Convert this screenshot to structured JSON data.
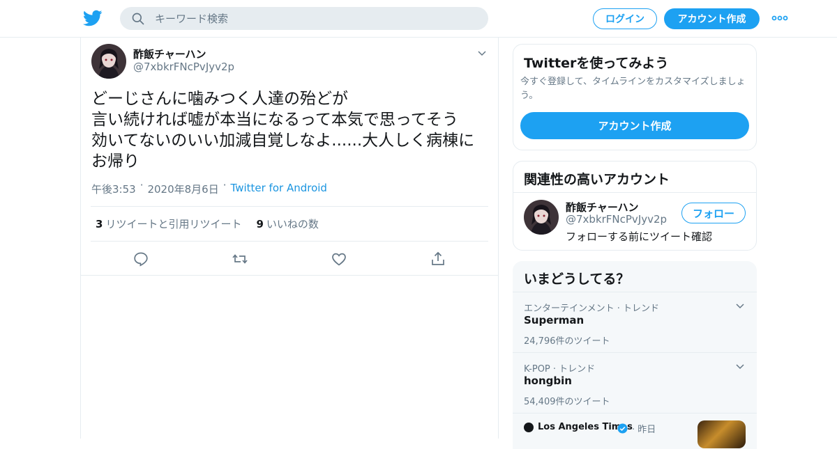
{
  "header": {
    "search_placeholder": "キーワード検索",
    "login_label": "ログイン",
    "signup_label": "アカウント作成",
    "brand_color": "#1da1f2"
  },
  "tweet": {
    "author_name": "酢飯チャーハン",
    "author_handle": "@7xbkrFNcPvJyv2p",
    "text": "どーじさんに噛みつく人達の殆どが\n言い続ければ嘘が本当になるって本気で思ってそう\n効いてないのいい加減自覚しなよ......大人しく病棟に\nお帰り",
    "time": "午後3:53",
    "date": "2020年8月6日",
    "source": "Twitter for Android",
    "retweet_count": "3",
    "retweet_label": "リツイートと引用リツイート",
    "like_count": "9",
    "like_label": "いいねの数"
  },
  "sidebar": {
    "join_card": {
      "title": "Twitterを使ってみよう",
      "description": "今すぐ登録して、タイムラインをカスタマイズしましょう。",
      "button": "アカウント作成"
    },
    "related_card": {
      "title": "関連性の高いアカウント",
      "name": "酢飯チャーハン",
      "handle": "@7xbkrFNcPvJyv2p",
      "follow_label": "フォロー",
      "note": "フォローする前にツイート確認"
    },
    "trends": {
      "title": "いまどうしてる？",
      "items": [
        {
          "category": "エンターテインメント · トレンド",
          "name": "Superman",
          "count": "24,796件のツイート"
        },
        {
          "category": "K-POP · トレンド",
          "name": "hongbin",
          "count": "54,409件のツイート"
        }
      ],
      "news": {
        "source": "Los Angeles Times",
        "time": "· 昨日"
      }
    }
  }
}
